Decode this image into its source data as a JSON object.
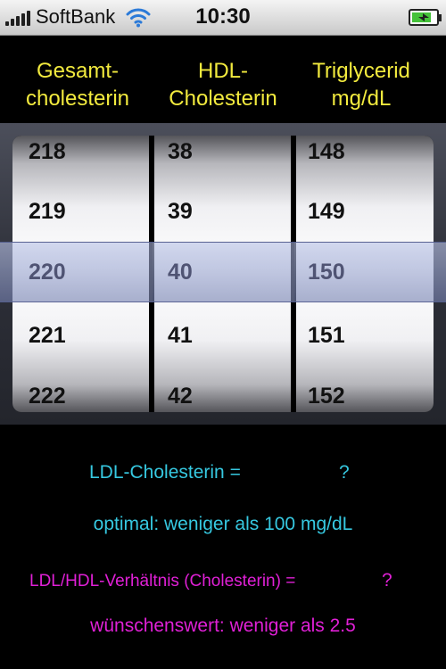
{
  "status_bar": {
    "carrier": "SoftBank",
    "time": "10:30",
    "signal_icon": "signal-bars-icon",
    "wifi_icon": "wifi-icon",
    "battery_icon": "battery-charging-icon",
    "battery_level": 0.8
  },
  "columns": [
    {
      "header_line1": "Gesamt-",
      "header_line2": "cholesterin"
    },
    {
      "header_line1": "HDL-",
      "header_line2": "Cholesterin"
    },
    {
      "header_line1": "Triglycerid",
      "header_line2": "mg/dL"
    }
  ],
  "picker": {
    "wheels": [
      {
        "items": [
          "218",
          "219",
          "221",
          "222"
        ],
        "selected": "220"
      },
      {
        "items": [
          "38",
          "39",
          "41",
          "42"
        ],
        "selected": "40"
      },
      {
        "items": [
          "148",
          "149",
          "151",
          "152"
        ],
        "selected": "150"
      }
    ]
  },
  "result": {
    "ldl_label": "LDL-Cholesterin =",
    "ldl_value": "?",
    "optimal_text": "optimal: weniger als 100 mg/dL",
    "ratio_label": "LDL/HDL-Verhältnis (Cholesterin) =",
    "ratio_value": "?",
    "desired_text": "wünschenswert: weniger als 2.5"
  },
  "colors": {
    "header_text": "#f2ea3e",
    "ldl_text": "#36c8e0",
    "ratio_text": "#e020d6",
    "background": "#000000"
  }
}
